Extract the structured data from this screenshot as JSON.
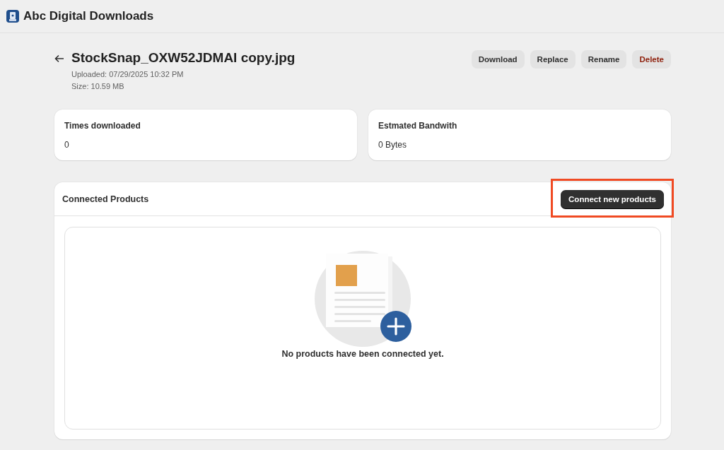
{
  "app": {
    "title": "Abc Digital Downloads"
  },
  "file": {
    "name": "StockSnap_OXW52JDMAI copy.jpg",
    "uploaded": "Uploaded: 07/29/2025 10:32 PM",
    "size": "Size: 10.59 MB"
  },
  "actions": [
    {
      "label": "Download",
      "kind": "normal"
    },
    {
      "label": "Replace",
      "kind": "normal"
    },
    {
      "label": "Rename",
      "kind": "normal"
    },
    {
      "label": "Delete",
      "kind": "danger"
    }
  ],
  "stats": [
    {
      "label": "Times downloaded",
      "value": "0"
    },
    {
      "label": "Estmated Bandwith",
      "value": "0 Bytes"
    }
  ],
  "connected_products": {
    "title": "Connected Products",
    "button": {
      "label": "Connect new products",
      "highlighted": true
    },
    "empty_message": "No products have been connected yet."
  }
}
